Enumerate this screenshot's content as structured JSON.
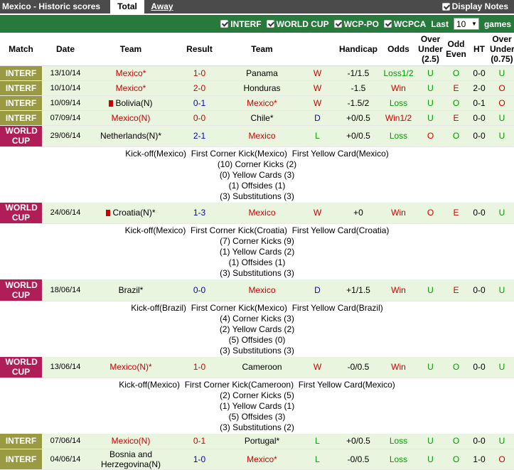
{
  "header": {
    "title": "Mexico - Historic scores",
    "tabs": [
      "Total",
      "Away"
    ],
    "display_notes_label": "Display Notes"
  },
  "filters": {
    "items": [
      "INTERF",
      "WORLD CUP",
      "WCP-PO",
      "WCPCA"
    ],
    "last_label": "Last",
    "last_value": "10",
    "games_label": "games"
  },
  "columns": {
    "match": "Match",
    "date": "Date",
    "team_home": "Team",
    "result": "Result",
    "team_away": "Team",
    "handicap": "Handicap",
    "odds": "Odds",
    "over_under_25": "Over Under (2.5)",
    "odd_even": "Odd Even",
    "ht": "HT",
    "over_under_075": "Over Under (0.75)"
  },
  "matches": [
    {
      "comp": "INTERF",
      "date": "13/10/14",
      "home": "Mexico*",
      "result": "1-0",
      "away": "Panama",
      "wdl": "W",
      "handicap": "-1/1.5",
      "odds": "Loss1/2",
      "ou": "U",
      "oe": "O",
      "ht": "0-0",
      "ou2": "U"
    },
    {
      "comp": "INTERF",
      "date": "10/10/14",
      "home": "Mexico*",
      "result": "2-0",
      "away": "Honduras",
      "wdl": "W",
      "handicap": "-1.5",
      "odds": "Win",
      "ou": "U",
      "oe": "E",
      "ht": "2-0",
      "ou2": "O"
    },
    {
      "comp": "INTERF",
      "date": "10/09/14",
      "home": "Bolivia(N)",
      "result": "0-1",
      "away": "Mexico*",
      "wdl": "W",
      "handicap": "-1.5/2",
      "odds": "Loss",
      "ou": "U",
      "oe": "O",
      "ht": "0-1",
      "ou2": "O"
    },
    {
      "comp": "INTERF",
      "date": "07/09/14",
      "home": "Mexico(N)",
      "result": "0-0",
      "away": "Chile*",
      "wdl": "D",
      "handicap": "+0/0.5",
      "odds": "Win1/2",
      "ou": "U",
      "oe": "E",
      "ht": "0-0",
      "ou2": "U"
    },
    {
      "comp": "WORLD CUP",
      "date": "29/06/14",
      "home": "Netherlands(N)*",
      "result": "2-1",
      "away": "Mexico",
      "wdl": "L",
      "handicap": "+0/0.5",
      "odds": "Loss",
      "ou": "O",
      "oe": "O",
      "ht": "0-0",
      "ou2": "U",
      "notes": [
        "Kick-off(Mexico)  First Corner Kick(Mexico)  First Yellow Card(Mexico)",
        "(10) Corner Kicks (2)",
        "(0) Yellow Cards (3)",
        "(1) Offsides (1)",
        "(3) Substitutions (3)"
      ]
    },
    {
      "comp": "WORLD CUP",
      "date": "24/06/14",
      "home": "Croatia(N)*",
      "result": "1-3",
      "away": "Mexico",
      "wdl": "W",
      "handicap": "+0",
      "odds": "Win",
      "ou": "O",
      "oe": "E",
      "ht": "0-0",
      "ou2": "U",
      "notes": [
        "Kick-off(Mexico)  First Corner Kick(Croatia)  First Yellow Card(Croatia)",
        "(7) Corner Kicks (9)",
        "(1) Yellow Cards (2)",
        "(1) Offsides (1)",
        "(3) Substitutions (3)"
      ]
    },
    {
      "comp": "WORLD CUP",
      "date": "18/06/14",
      "home": "Brazil*",
      "result": "0-0",
      "away": "Mexico",
      "wdl": "D",
      "handicap": "+1/1.5",
      "odds": "Win",
      "ou": "U",
      "oe": "E",
      "ht": "0-0",
      "ou2": "U",
      "notes": [
        "Kick-off(Brazil)  First Corner Kick(Mexico)  First Yellow Card(Brazil)",
        "(4) Corner Kicks (3)",
        "(2) Yellow Cards (2)",
        "(5) Offsides (0)",
        "(3) Substitutions (3)"
      ]
    },
    {
      "comp": "WORLD CUP",
      "date": "13/06/14",
      "home": "Mexico(N)*",
      "result": "1-0",
      "away": "Cameroon",
      "wdl": "W",
      "handicap": "-0/0.5",
      "odds": "Win",
      "ou": "U",
      "oe": "O",
      "ht": "0-0",
      "ou2": "U",
      "notes": [
        "Kick-off(Mexico)  First Corner Kick(Cameroon)  First Yellow Card(Mexico)",
        "(2) Corner Kicks (5)",
        "(1) Yellow Cards (1)",
        "(5) Offsides (3)",
        "(3) Substitutions (2)"
      ]
    },
    {
      "comp": "INTERF",
      "date": "07/06/14",
      "home": "Mexico(N)",
      "result": "0-1",
      "away": "Portugal*",
      "wdl": "L",
      "handicap": "+0/0.5",
      "odds": "Loss",
      "ou": "U",
      "oe": "O",
      "ht": "0-0",
      "ou2": "U"
    },
    {
      "comp": "INTERF",
      "date": "04/06/14",
      "home": "Bosnia and Herzegovina(N)",
      "result": "1-0",
      "away": "Mexico*",
      "wdl": "L",
      "handicap": "-0/0.5",
      "odds": "Loss",
      "ou": "U",
      "oe": "O",
      "ht": "1-0",
      "ou2": "O"
    }
  ]
}
